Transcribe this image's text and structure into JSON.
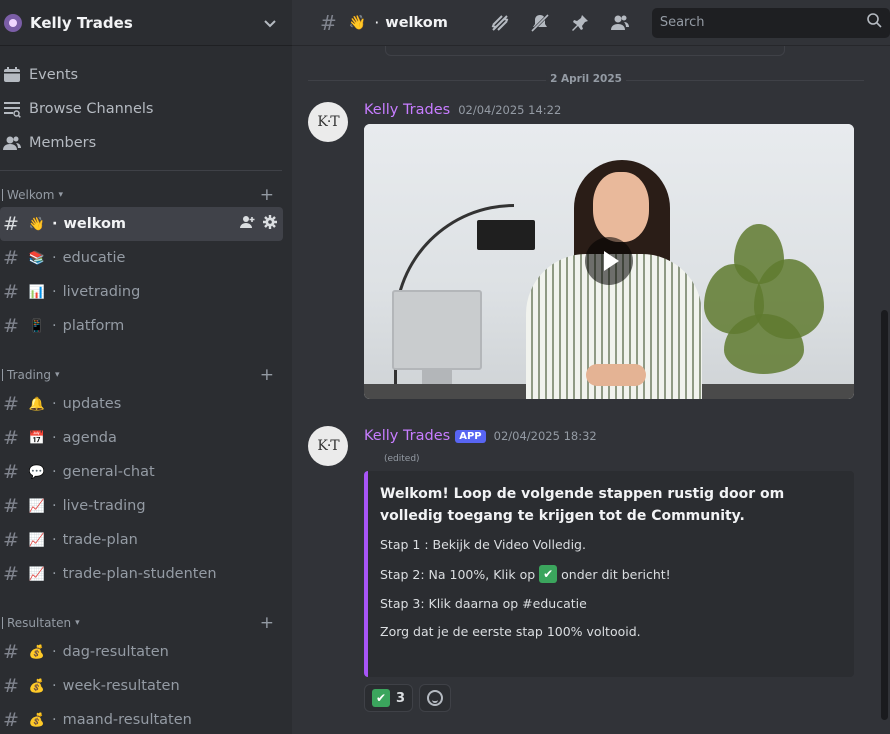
{
  "server": {
    "name": "Kelly Trades"
  },
  "nav": [
    {
      "label": "Events",
      "icon": "calendar-icon"
    },
    {
      "label": "Browse Channels",
      "icon": "browse-channels-icon"
    },
    {
      "label": "Members",
      "icon": "members-icon"
    }
  ],
  "categories": [
    {
      "name": "Welkom",
      "channels": [
        {
          "name": "welkom",
          "emoji": "👋",
          "active": true
        },
        {
          "name": "educatie",
          "emoji": "📚"
        },
        {
          "name": "livetrading",
          "emoji": "📊"
        },
        {
          "name": "platform",
          "emoji": "📱"
        }
      ]
    },
    {
      "name": "Trading",
      "channels": [
        {
          "name": "updates",
          "emoji": "🔔"
        },
        {
          "name": "agenda",
          "emoji": "📅"
        },
        {
          "name": "general-chat",
          "emoji": "💬"
        },
        {
          "name": "live-trading",
          "emoji": "📈"
        },
        {
          "name": "trade-plan",
          "emoji": "📈"
        },
        {
          "name": "trade-plan-studenten",
          "emoji": "📈"
        }
      ]
    },
    {
      "name": "Resultaten",
      "channels": [
        {
          "name": "dag-resultaten",
          "emoji": "💰"
        },
        {
          "name": "week-resultaten",
          "emoji": "💰"
        },
        {
          "name": "maand-resultaten",
          "emoji": "💰"
        }
      ]
    }
  ],
  "topbar": {
    "channel_emoji": "👋",
    "channel_name": "welkom",
    "search_placeholder": "Search"
  },
  "chat": {
    "date_separator": "2 April 2025",
    "messages": [
      {
        "author": "Kelly Trades",
        "avatar_text": "K·T",
        "timestamp": "02/04/2025 14:22",
        "attachment": "video",
        "author_color": "#c77dff"
      },
      {
        "author": "Kelly Trades",
        "avatar_text": "K·T",
        "badge": "APP",
        "timestamp": "02/04/2025 18:32",
        "edited": "(edited)",
        "embed": {
          "accent": "#a855f7",
          "title": "Welkom! Loop de volgende stappen rustig door om volledig toegang te krijgen tot de Community.",
          "step1": "Stap 1 : Bekijk de Video Volledig.",
          "step2_before": "Stap 2: Na 100%, Klik op",
          "step2_after": "onder dit bericht!",
          "step3": "Stap 3: Klik daarna op #educatie",
          "footer": "Zorg dat je de eerste stap 100% voltooid."
        },
        "reactions": [
          {
            "emoji": "✅",
            "count": "3"
          }
        ]
      }
    ]
  },
  "colors": {
    "sidebar_bg": "#2b2d31",
    "chat_bg": "#313338",
    "brand_blurple": "#5865f2",
    "author_purple": "#c77dff"
  }
}
